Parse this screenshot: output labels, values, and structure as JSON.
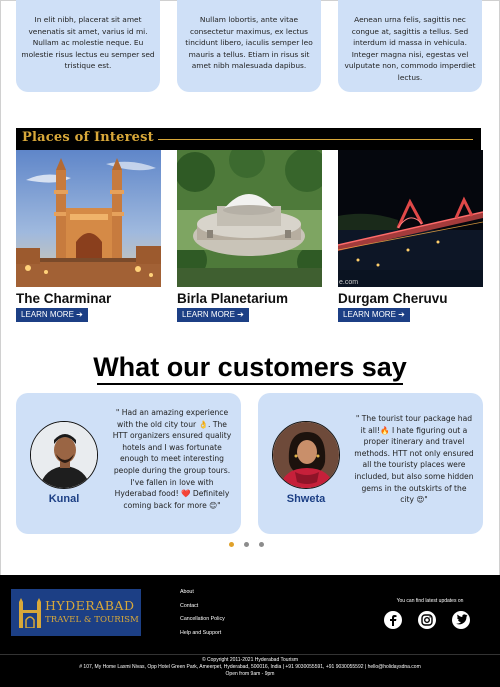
{
  "top_cards": [
    {
      "text": "In elit nibh, placerat sit amet venenatis sit amet, varius id mi. Nullam ac molestie neque. Eu molestie risus lectus eu semper sed tristique est."
    },
    {
      "text": "Nullam lobortis, ante vitae consectetur maximus, ex lectus tincidunt libero, iaculis semper leo mauris a tellus. Etiam in risus sit amet nibh malesuada dapibus."
    },
    {
      "text": "Aenean urna felis, sagittis nec congue at, sagittis a tellus. Sed interdum id massa in vehicula. Integer magna nisi, egestas vel vulputate non, commodo imperdiet lectus."
    }
  ],
  "places": {
    "title": "Places of Interest",
    "items": [
      {
        "name": "The Charminar",
        "button": "LEARN MORE ➔"
      },
      {
        "name": "Birla Planetarium",
        "button": "LEARN MORE ➔"
      },
      {
        "name": "Durgam Cheruvu",
        "button": "LEARN MORE ➔",
        "watermark": "e.com"
      }
    ]
  },
  "customers": {
    "heading": "What our customers say",
    "reviews": [
      {
        "name": "Kunal",
        "text": "\" Had an amazing experience with the old city tour 👌. The HTT organizers ensured quality hotels and I was fortunate enough to meet interesting people during the group tours. I've fallen in love with Hyderabad food! ❤️ Definitely coming back for more 😊\""
      },
      {
        "name": "Shweta",
        "text": "\" The tourist tour package had it all!🔥 I hate figuring out a proper itinerary and travel methods. HTT not only ensured all the touristy places were included, but also some hidden gems in the outskirts of the city 😍\""
      }
    ],
    "active_slide": 1
  },
  "footer": {
    "logo_line1": "HYDERABAD",
    "logo_line2": "TRAVEL & TOURISM",
    "links": [
      "About",
      "Contact",
      "Cancellation Policy",
      "Help and Support"
    ],
    "social_label": "You can find latest updates on",
    "social_icons": [
      "facebook-icon",
      "instagram-icon",
      "twitter-icon"
    ],
    "copyright": "© Copyright 2011-2021 Hyderabad Tourism",
    "address": "# 107, My Home Laxmi Nivas, Opp Hotel Green Park, Ameerpet, Hyderabad, 500016, India | +91 9030055591, +91 9030055592 | hello@holidaysdna.com",
    "hours": "Open from 9am - 9pm"
  },
  "colors": {
    "card_bg": "#cfe0f7",
    "brand_blue": "#1c3f85",
    "gold": "#d8a83a",
    "active_dot": "#e0a12a"
  }
}
